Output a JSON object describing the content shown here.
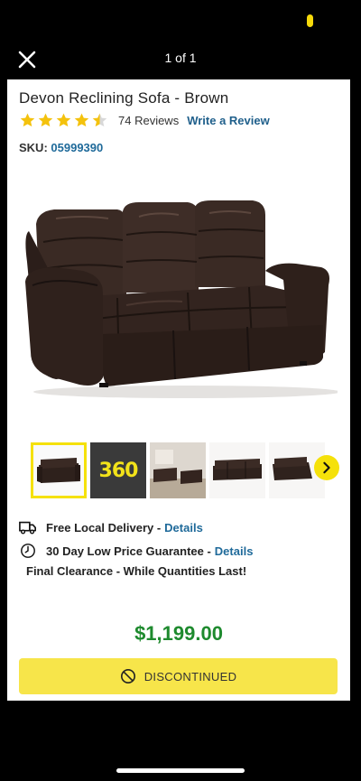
{
  "header": {
    "counter": "1 of 1"
  },
  "product": {
    "title": "Devon Reclining Sofa - Brown",
    "rating": 4.5,
    "reviews_text": "74 Reviews",
    "write_review": "Write a Review",
    "sku_label": "SKU:",
    "sku_value": "05999390",
    "price": "$1,199.00"
  },
  "thumbnails": [
    {
      "name": "sofa-front",
      "selected": true
    },
    {
      "name": "360-view",
      "label": "360",
      "selected": false
    },
    {
      "name": "room-scene",
      "selected": false
    },
    {
      "name": "sofa-set",
      "selected": false
    },
    {
      "name": "sofa-reclined",
      "selected": false
    }
  ],
  "perks": {
    "delivery_text": "Free Local Delivery -",
    "delivery_link": "Details",
    "guarantee_text": "30 Day Low Price Guarantee -",
    "guarantee_link": "Details"
  },
  "clearance": "Final Clearance - While Quantities Last!",
  "button": {
    "label": "DISCONTINUED"
  },
  "colors": {
    "accent_yellow": "#f5e10a",
    "price_green": "#1e8a2e",
    "link_blue": "#1f6a9a"
  },
  "icons": [
    "close-icon",
    "star-icon",
    "truck-icon",
    "clock-icon",
    "chevron-right-icon",
    "no-entry-icon"
  ]
}
